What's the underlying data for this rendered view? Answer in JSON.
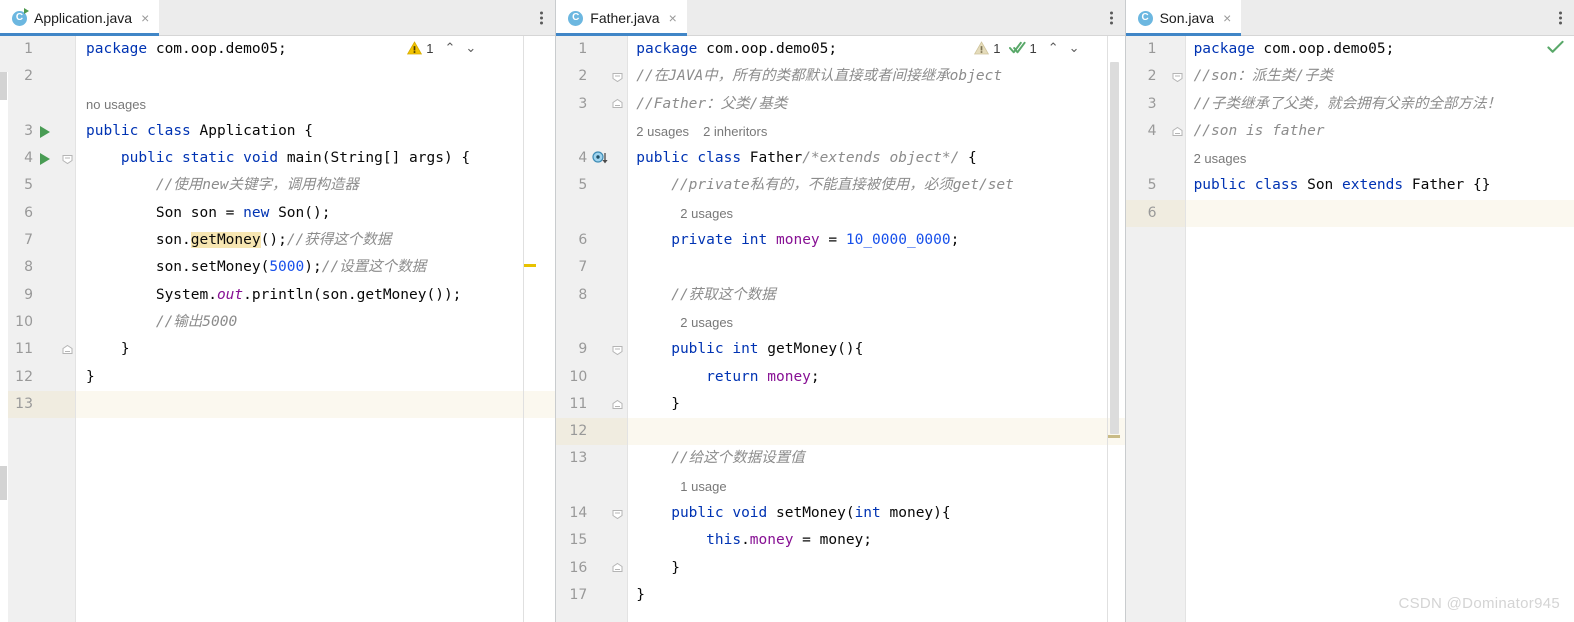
{
  "watermark": "CSDN @Dominator945",
  "panels": [
    {
      "id": "application",
      "tab": {
        "label": "Application.java",
        "icon": "java-class-runnable-icon",
        "close": "×"
      },
      "inspection": {
        "warning_count": "1",
        "up": "⌃",
        "down": "⌄"
      },
      "lines": [
        {
          "no": "1",
          "type": "code",
          "html": "<span class=\"kw\">package</span> com.oop.demo05;"
        },
        {
          "no": "2",
          "type": "code",
          "html": ""
        },
        {
          "no": "",
          "type": "hint",
          "text": "no usages"
        },
        {
          "no": "3",
          "type": "code",
          "html": "<span class=\"kw\">public</span> <span class=\"kw\">class</span> Application {",
          "gutter": "run"
        },
        {
          "no": "4",
          "type": "code",
          "html": "    <span class=\"kw\">public</span> <span class=\"kw\">static</span> <span class=\"kw\">void</span> <span class=\"id\">main</span>(String[] args) {",
          "gutter": "run-fold"
        },
        {
          "no": "5",
          "type": "code",
          "html": "        <span class=\"cmt\">//使用new关键字，调用构造器</span>"
        },
        {
          "no": "6",
          "type": "code",
          "html": "        Son son = <span class=\"kw\">new</span> Son();"
        },
        {
          "no": "7",
          "type": "code",
          "html": "        son.<span class=\"mark\">getMoney</span>();<span class=\"cmt\">//获得这个数据</span>"
        },
        {
          "no": "8",
          "type": "code",
          "html": "        son.setMoney(<span class=\"num\">5000</span>);<span class=\"cmt\">//设置这个数据</span>"
        },
        {
          "no": "9",
          "type": "code",
          "html": "        System.<span class=\"stat\">out</span>.println(son.getMoney());"
        },
        {
          "no": "10",
          "type": "code",
          "html": "        <span class=\"cmt\">//输出5000</span>"
        },
        {
          "no": "11",
          "type": "code",
          "html": "    }",
          "gutter": "fold-end"
        },
        {
          "no": "12",
          "type": "code",
          "html": "}"
        },
        {
          "no": "13",
          "type": "code",
          "html": "",
          "highlight": true
        }
      ]
    },
    {
      "id": "father",
      "tab": {
        "label": "Father.java",
        "icon": "java-class-icon",
        "close": "×"
      },
      "inspection": {
        "warning_count": "1",
        "ok_count": "1",
        "up": "⌃",
        "down": "⌄"
      },
      "lines": [
        {
          "no": "1",
          "type": "code",
          "html": "<span class=\"kw\">package</span> com.oop.demo05;"
        },
        {
          "no": "2",
          "type": "code",
          "html": "<span class=\"cmt\">//在JAVA中，所有的类都默认直接或者间接继承object</span>",
          "gutter": "fold-start"
        },
        {
          "no": "3",
          "type": "code",
          "html": "<span class=\"cmt\">//Father：父类/基类</span>",
          "gutter": "fold-end"
        },
        {
          "no": "",
          "type": "hint",
          "text": "2 usages",
          "text2": "2 inheritors"
        },
        {
          "no": "4",
          "type": "code",
          "html": "<span class=\"kw\">public</span> <span class=\"kw\">class</span> Father<span class=\"cmt\">/*extends object*/</span> {",
          "gutter": "impl"
        },
        {
          "no": "5",
          "type": "code",
          "html": "    <span class=\"cmt\">//private私有的，不能直接被使用，必须get/set</span>"
        },
        {
          "no": "",
          "type": "hint",
          "text": "2 usages",
          "indent": true
        },
        {
          "no": "6",
          "type": "code",
          "html": "    <span class=\"kw\">private</span> <span class=\"kw\">int</span> <span class=\"fld\">money</span> = <span class=\"num\">10_0000_0000</span>;"
        },
        {
          "no": "7",
          "type": "code",
          "html": ""
        },
        {
          "no": "8",
          "type": "code",
          "html": "    <span class=\"cmt\">//获取这个数据</span>"
        },
        {
          "no": "",
          "type": "hint",
          "text": "2 usages",
          "indent": true
        },
        {
          "no": "9",
          "type": "code",
          "html": "    <span class=\"kw\">public</span> <span class=\"kw\">int</span> <span class=\"id\">getMoney</span>(){",
          "gutter": "fold-start"
        },
        {
          "no": "10",
          "type": "code",
          "html": "        <span class=\"kw\">return</span> <span class=\"fld\">money</span>;"
        },
        {
          "no": "11",
          "type": "code",
          "html": "    }",
          "gutter": "fold-end"
        },
        {
          "no": "12",
          "type": "code",
          "html": "",
          "highlight": true
        },
        {
          "no": "13",
          "type": "code",
          "html": "    <span class=\"cmt\">//给这个数据设置值</span>"
        },
        {
          "no": "",
          "type": "hint",
          "text": "1 usage",
          "indent": true
        },
        {
          "no": "14",
          "type": "code",
          "html": "    <span class=\"kw\">public</span> <span class=\"kw\">void</span> <span class=\"id\">setMoney</span>(<span class=\"kw\">int</span> money){",
          "gutter": "fold-start"
        },
        {
          "no": "15",
          "type": "code",
          "html": "        <span class=\"kw\">this</span>.<span class=\"fld\">money</span> = money;"
        },
        {
          "no": "16",
          "type": "code",
          "html": "    }",
          "gutter": "fold-end"
        },
        {
          "no": "17",
          "type": "code",
          "html": "}"
        }
      ]
    },
    {
      "id": "son",
      "tab": {
        "label": "Son.java",
        "icon": "java-class-icon",
        "close": "×"
      },
      "inspection": {
        "ok_only": true
      },
      "lines": [
        {
          "no": "1",
          "type": "code",
          "html": "<span class=\"kw\">package</span> com.oop.demo05;"
        },
        {
          "no": "2",
          "type": "code",
          "html": "<span class=\"cmt\">//son：派生类/子类</span>",
          "gutter": "fold-start"
        },
        {
          "no": "3",
          "type": "code",
          "html": "<span class=\"cmt\">//子类继承了父类，就会拥有父亲的全部方法！</span>"
        },
        {
          "no": "4",
          "type": "code",
          "html": "<span class=\"cmt\">//son is father</span>",
          "gutter": "fold-end"
        },
        {
          "no": "",
          "type": "hint",
          "text": "2 usages"
        },
        {
          "no": "5",
          "type": "code",
          "html": "<span class=\"kw\">public</span> <span class=\"kw\">class</span> Son <span class=\"kw\">extends</span> Father {}"
        },
        {
          "no": "6",
          "type": "code",
          "html": "",
          "highlight": true
        }
      ]
    }
  ],
  "colors": {
    "keyword": "#0033b3",
    "number": "#1750eb",
    "comment": "#8c8c8c",
    "field": "#871094",
    "tab_underline": "#4086c7",
    "warning": "#f2c300",
    "ok": "#59a869",
    "caret_row": "#fbf8ef",
    "identifier_highlight": "#f7e6b2"
  }
}
